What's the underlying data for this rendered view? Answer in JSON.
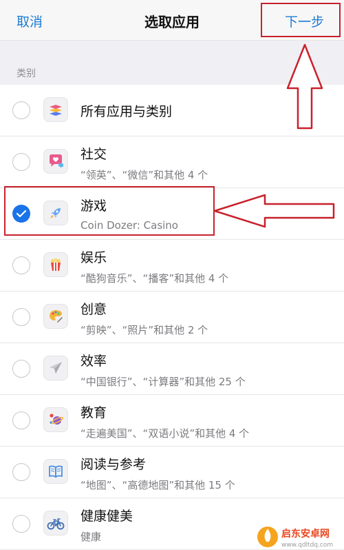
{
  "nav": {
    "cancel_label": "取消",
    "title": "选取应用",
    "next_label": "下一步"
  },
  "section": {
    "header": "类别"
  },
  "items": [
    {
      "title": "所有应用与类别",
      "subtitle": "",
      "checked": false,
      "icon": "stack-layers-icon"
    },
    {
      "title": "社交",
      "subtitle": "“领英”、“微信”和其他 4 个",
      "checked": false,
      "icon": "chat-heart-icon"
    },
    {
      "title": "游戏",
      "subtitle": "Coin Dozer: Casino",
      "checked": true,
      "icon": "rocket-icon"
    },
    {
      "title": "娱乐",
      "subtitle": "“酷狗音乐”、“播客”和其他 4 个",
      "checked": false,
      "icon": "popcorn-icon"
    },
    {
      "title": "创意",
      "subtitle": "“剪映”、“照片”和其他 2 个",
      "checked": false,
      "icon": "palette-icon"
    },
    {
      "title": "效率",
      "subtitle": "“中国银行”、“计算器”和其他 25 个",
      "checked": false,
      "icon": "paper-plane-icon"
    },
    {
      "title": "教育",
      "subtitle": "“走遍美国”、“双语小说”和其他 4 个",
      "checked": false,
      "icon": "planet-icon"
    },
    {
      "title": "阅读与参考",
      "subtitle": "“地图”、“高德地图”和其他 15 个",
      "checked": false,
      "icon": "open-book-icon"
    },
    {
      "title": "健康健美",
      "subtitle": "健康",
      "checked": false,
      "icon": "bicycle-icon"
    }
  ],
  "watermark": {
    "text": "启东安卓网",
    "url": "www.qdltdq.com"
  },
  "colors": {
    "accent": "#1a7bd6",
    "check": "#1a73e8",
    "annotation": "#c8212b"
  }
}
